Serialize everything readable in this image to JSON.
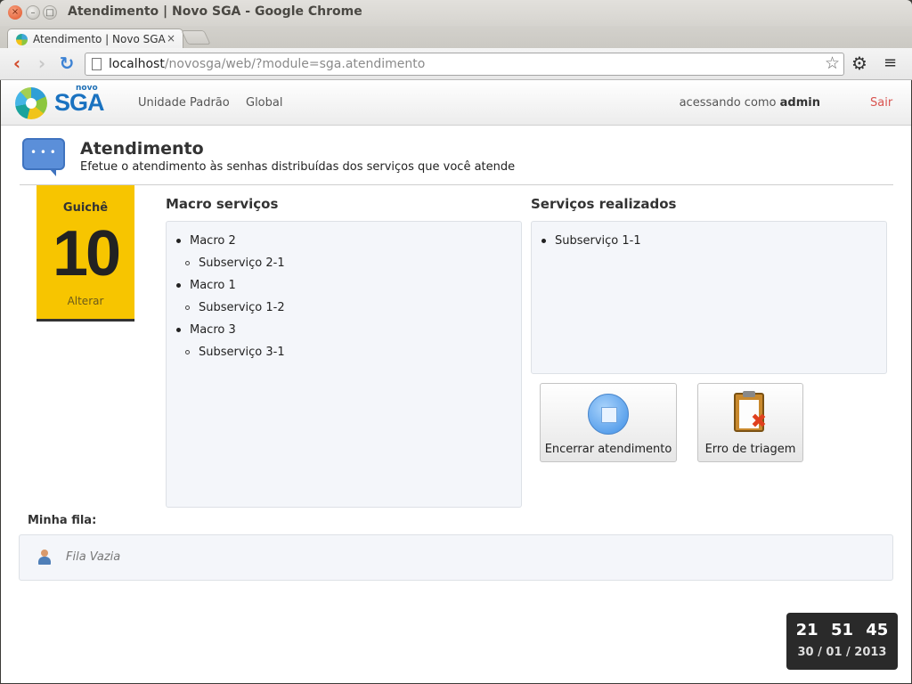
{
  "window": {
    "title": "Atendimento | Novo SGA - Google Chrome",
    "close_glyph": "×",
    "minimize_glyph": "–",
    "maximize_glyph": "□"
  },
  "browser": {
    "tab_title": "Atendimento | Novo SGA",
    "tab_close": "×",
    "url_host": "localhost",
    "url_path": "/novosga/web/?module=sga.atendimento",
    "icons": {
      "back": "‹",
      "forward": "›",
      "reload": "↻",
      "star": "☆",
      "settings": "⚙",
      "menu": "≡"
    }
  },
  "header": {
    "logo_small": "novo",
    "logo_big": "SGA",
    "nav": {
      "unit": "Unidade Padrão",
      "global": "Global"
    },
    "user_prefix": "acessando como",
    "user_name": "admin",
    "logout": "Sair"
  },
  "page": {
    "title": "Atendimento",
    "subtitle": "Efetue o atendimento às senhas distribuídas dos serviços que você atende"
  },
  "guiche": {
    "label": "Guichê",
    "number": "10",
    "change": "Alterar"
  },
  "macro": {
    "title": "Macro serviços",
    "items": [
      {
        "label": "Macro 2",
        "sub": [
          "Subserviço 2-1"
        ]
      },
      {
        "label": "Macro 1",
        "sub": [
          "Subserviço 1-2"
        ]
      },
      {
        "label": "Macro 3",
        "sub": [
          "Subserviço 3-1"
        ]
      }
    ]
  },
  "done": {
    "title": "Serviços realizados",
    "items": [
      "Subserviço 1-1"
    ]
  },
  "actions": {
    "end_label": "Encerrar atendimento",
    "error_label": "Erro de triagem"
  },
  "queue": {
    "label": "Minha fila:",
    "empty": "Fila Vazia"
  },
  "clock": {
    "time": "21 51 45",
    "date": "30 / 01 / 2013"
  },
  "colors": {
    "guiche_bg": "#f7c500",
    "brand_blue": "#1a72c0",
    "logout_red": "#d9534f"
  }
}
